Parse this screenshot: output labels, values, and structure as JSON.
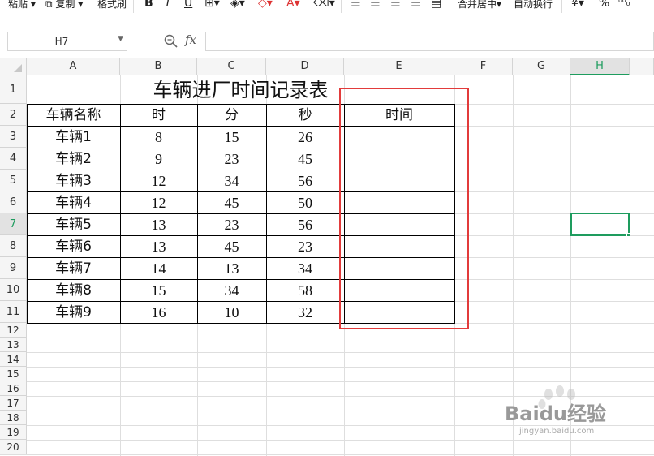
{
  "toolbar": {
    "paste": "粘贴",
    "copy": "复制",
    "format_painter": "格式刷",
    "bold": "B",
    "italic": "I",
    "underline": "U",
    "merge_center": "合并居中",
    "wrap_text": "自动换行",
    "currency": "¥",
    "percent": "%"
  },
  "formula_bar": {
    "name_box": "H7",
    "fx_label": "fx",
    "formula": ""
  },
  "columns": [
    "A",
    "B",
    "C",
    "D",
    "E",
    "F",
    "G",
    "H"
  ],
  "rows": [
    "1",
    "2",
    "3",
    "4",
    "5",
    "6",
    "7",
    "8",
    "9",
    "10",
    "11",
    "12",
    "13",
    "14",
    "15",
    "16",
    "17",
    "18",
    "19",
    "20"
  ],
  "selected_cell": "H7",
  "sheet": {
    "title": "车辆进厂时间记录表",
    "headers": [
      "车辆名称",
      "时",
      "分",
      "秒",
      "时间"
    ],
    "data": [
      [
        "车辆1",
        "8",
        "15",
        "26",
        ""
      ],
      [
        "车辆2",
        "9",
        "23",
        "45",
        ""
      ],
      [
        "车辆3",
        "12",
        "34",
        "56",
        ""
      ],
      [
        "车辆4",
        "12",
        "45",
        "50",
        ""
      ],
      [
        "车辆5",
        "13",
        "23",
        "56",
        ""
      ],
      [
        "车辆6",
        "13",
        "45",
        "23",
        ""
      ],
      [
        "车辆7",
        "14",
        "13",
        "34",
        ""
      ],
      [
        "车辆8",
        "15",
        "34",
        "58",
        ""
      ],
      [
        "车辆9",
        "16",
        "10",
        "32",
        ""
      ]
    ]
  },
  "annotation": {
    "highlight_color": "#e23b3b"
  },
  "watermark": {
    "text": "Baidu经验",
    "url": "jingyan.baidu.com"
  },
  "colors": {
    "selection": "#1e9c5e",
    "grid": "#dedede",
    "header_bg": "#f5f5f5"
  }
}
